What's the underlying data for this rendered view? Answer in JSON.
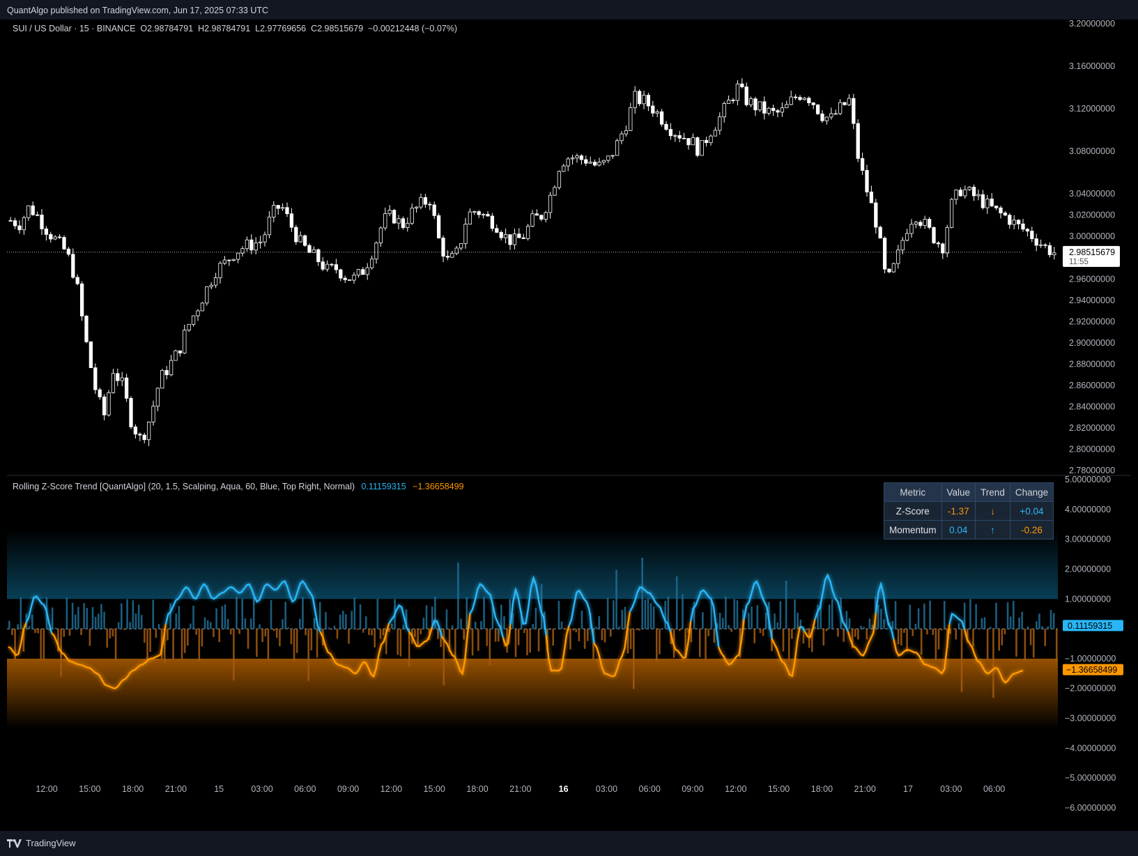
{
  "header": {
    "published": "QuantAlgo published on TradingView.com, Jun 17, 2025 07:33 UTC"
  },
  "footer": {
    "brand": "TradingView"
  },
  "main_legend": {
    "symbol": "SUI / US Dollar · 15 · BINANCE",
    "open": "O2.98784791",
    "high": "H2.98784791",
    "low": "L2.97769656",
    "close": "C2.98515679",
    "change": "−0.00212448 (−0.07%)"
  },
  "indicator_legend": {
    "name": "Rolling Z-Score Trend [QuantAlgo] (20, 1.5, Scalping, Aqua, 60, Blue, Top Right, Normal)",
    "value1": "0.11159315",
    "value2": "−1.36658499"
  },
  "price_label": {
    "value": "2.98515679",
    "countdown": "11:55"
  },
  "ind_labels": {
    "z": "0.11159315",
    "m": "−1.36658499"
  },
  "table": {
    "headers": [
      "Metric",
      "Value",
      "Trend",
      "Change"
    ],
    "rows": [
      {
        "metric": "Z-Score",
        "value": "-1.37",
        "trend": "↓",
        "change": "+0.04"
      },
      {
        "metric": "Momentum",
        "value": "0.04",
        "trend": "↑",
        "change": "-0.26"
      }
    ]
  },
  "colors": {
    "bg": "#000000",
    "aqua": "#29b6f6",
    "orange": "#ff9800",
    "candle": "#ffffff",
    "panel": "#131722"
  },
  "chart_data": [
    {
      "type": "candlestick",
      "title": "SUI / US Dollar · 15 · BINANCE",
      "ylim": [
        2.78,
        3.2
      ],
      "y_ticks": [
        "3.20000000",
        "3.16000000",
        "3.12000000",
        "3.08000000",
        "3.04000000",
        "3.02000000",
        "3.00000000",
        "2.96000000",
        "2.94000000",
        "2.92000000",
        "2.90000000",
        "2.88000000",
        "2.86000000",
        "2.84000000",
        "2.82000000",
        "2.80000000",
        "2.78000000"
      ],
      "x_ticks": [
        "12:00",
        "15:00",
        "18:00",
        "21:00",
        "15",
        "03:00",
        "06:00",
        "09:00",
        "12:00",
        "15:00",
        "18:00",
        "21:00",
        "16",
        "03:00",
        "06:00",
        "09:00",
        "12:00",
        "15:00",
        "18:00",
        "21:00",
        "17",
        "03:00",
        "06:00"
      ],
      "close_path": [
        3.015,
        3.012,
        3.028,
        3.018,
        3.005,
        2.995,
        2.985,
        2.96,
        2.905,
        2.86,
        2.83,
        2.875,
        2.86,
        2.825,
        2.808,
        2.83,
        2.865,
        2.878,
        2.892,
        2.915,
        2.932,
        2.95,
        2.968,
        2.975,
        2.985,
        2.99,
        2.993,
        2.996,
        3.02,
        3.03,
        3.012,
        2.995,
        2.985,
        2.978,
        2.968,
        2.97,
        2.962,
        2.96,
        2.97,
        2.99,
        3.015,
        3.02,
        3.01,
        3.022,
        3.03,
        3.035,
        2.995,
        2.975,
        2.985,
        3.02,
        3.025,
        3.018,
        3.013,
        3.0,
        2.995,
        3.0,
        3.015,
        3.02,
        3.04,
        3.07,
        3.075,
        3.073,
        3.072,
        3.065,
        3.07,
        3.085,
        3.105,
        3.13,
        3.127,
        3.12,
        3.11,
        3.1,
        3.095,
        3.09,
        3.08,
        3.098,
        3.11,
        3.125,
        3.14,
        3.128,
        3.122,
        3.118,
        3.115,
        3.118,
        3.13,
        3.135,
        3.128,
        3.115,
        3.11,
        3.12,
        3.128,
        3.072,
        3.04,
        3.01,
        2.955,
        2.975,
        3.005,
        3.022,
        3.012,
        3.0,
        2.99,
        3.03,
        3.045,
        3.04,
        3.035,
        3.028,
        3.022,
        3.018,
        3.01,
        3.005,
        2.998,
        2.99,
        2.985
      ],
      "yellow_wicks_note": "",
      "current_price": 2.98515679
    },
    {
      "type": "line+bar",
      "title": "Rolling Z-Score Trend [QuantAlgo] (20, 1.5, Scalping, Aqua, 60, Blue, Top Right, Normal)",
      "ylim": [
        -6,
        5
      ],
      "y_ticks": [
        "5.00000000",
        "4.00000000",
        "3.00000000",
        "2.00000000",
        "1.00000000",
        "−1.00000000",
        "−2.00000000",
        "−3.00000000",
        "−4.00000000",
        "−5.00000000",
        "−6.00000000"
      ],
      "thresholds": [
        1,
        -1
      ],
      "z_score_path": [
        -0.6,
        -0.9,
        0.2,
        1.1,
        0.8,
        -0.2,
        -0.8,
        -1.1,
        -1.2,
        -1.3,
        -1.5,
        -1.9,
        -2.0,
        -1.7,
        -1.4,
        -1.2,
        -1.0,
        -0.9,
        0.5,
        1.0,
        1.4,
        1.0,
        1.5,
        1.0,
        1.2,
        1.4,
        1.2,
        1.5,
        0.9,
        1.5,
        1.3,
        1.6,
        0.9,
        1.6,
        1.2,
        -0.1,
        -0.8,
        -1.2,
        -1.3,
        -1.5,
        -1.1,
        -1.6,
        -0.5,
        0.3,
        0.8,
        -0.1,
        -0.6,
        -0.4,
        0.3,
        -0.4,
        -0.9,
        -1.5,
        0.6,
        1.5,
        1.2,
        0.2,
        -0.6,
        1.3,
        0.1,
        1.7,
        0.5,
        -1.4,
        -1.4,
        0.1,
        1.3,
        0.9,
        -0.6,
        -1.5,
        -1.6,
        -0.9,
        0.7,
        1.4,
        1.2,
        0.8,
        0.2,
        -0.7,
        -1.0,
        0.7,
        1.3,
        1.0,
        -0.8,
        -1.2,
        -0.9,
        0.8,
        1.6,
        0.9,
        -0.5,
        -1.1,
        -1.6,
        0.1,
        -0.3,
        0.6,
        1.8,
        1.0,
        0.1,
        -0.6,
        -0.9,
        -0.3,
        1.5,
        0.1,
        -0.9,
        -0.7,
        -0.8,
        -1.2,
        -1.3,
        -1.5,
        0.5,
        0.3,
        -0.5,
        -1.1,
        -1.5,
        -1.3,
        -1.8,
        -1.5,
        -1.4
      ],
      "latest": {
        "z": 0.11159315,
        "momentum": -1.36658499
      }
    }
  ]
}
